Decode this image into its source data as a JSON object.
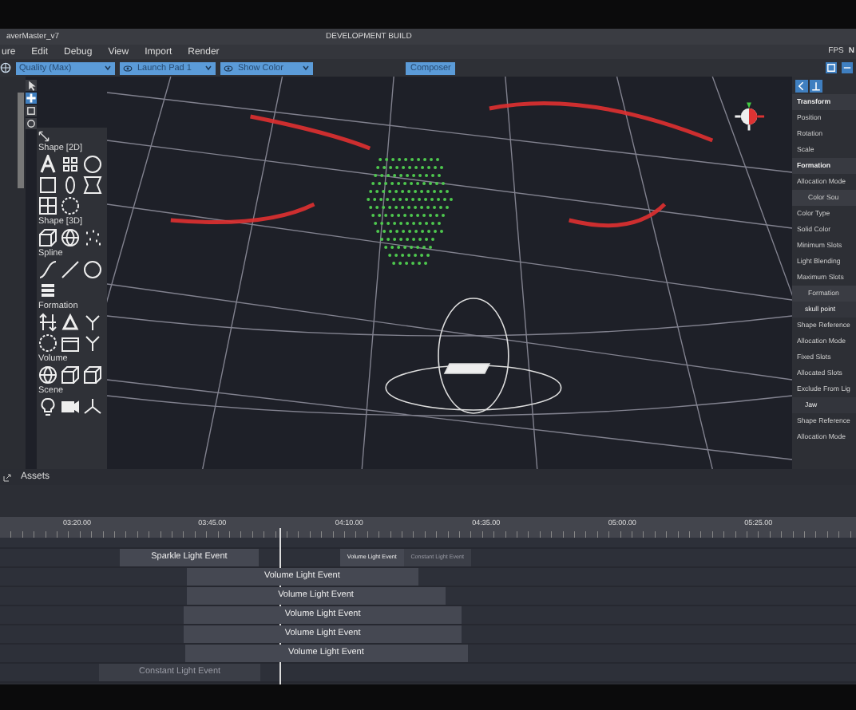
{
  "window": {
    "title": "averMaster_v7",
    "build": "DEVELOPMENT BUILD"
  },
  "menu": [
    "ure",
    "Edit",
    "Debug",
    "View",
    "Import",
    "Render"
  ],
  "toolbar": {
    "dropdowns": [
      "Quality (Max)",
      "Launch Pad 1",
      "Show Color"
    ],
    "composer": "Composer",
    "fps": "FPS",
    "fps_value": "N"
  },
  "palette": [
    "Shape [2D]",
    "Shape [3D]",
    "Spline",
    "Formation",
    "Volume",
    "Scene"
  ],
  "inspector": [
    {
      "kind": "header",
      "label": "Transform"
    },
    {
      "kind": "item",
      "label": "Position"
    },
    {
      "kind": "item",
      "label": "Rotation"
    },
    {
      "kind": "item",
      "label": "Scale"
    },
    {
      "kind": "header",
      "label": "Formation"
    },
    {
      "kind": "item",
      "label": "Allocation Mode"
    },
    {
      "kind": "sub",
      "label": "Color Sou"
    },
    {
      "kind": "item",
      "label": "Color Type"
    },
    {
      "kind": "item",
      "label": "Solid Color"
    },
    {
      "kind": "item",
      "label": "Minimum Slots"
    },
    {
      "kind": "item",
      "label": "Light Blending"
    },
    {
      "kind": "item",
      "label": "Maximum Slots"
    },
    {
      "kind": "sub",
      "label": "Formation"
    },
    {
      "kind": "list",
      "label": "skull point"
    },
    {
      "kind": "item",
      "label": "Shape Reference"
    },
    {
      "kind": "item",
      "label": "Allocation Mode"
    },
    {
      "kind": "item",
      "label": "Fixed Slots"
    },
    {
      "kind": "item",
      "label": "Allocated Slots"
    },
    {
      "kind": "item",
      "label": "Exclude From Lig"
    },
    {
      "kind": "list",
      "label": "Jaw"
    },
    {
      "kind": "item",
      "label": "Shape Reference"
    },
    {
      "kind": "item",
      "label": "Allocation Mode"
    }
  ],
  "assets": {
    "title": "Assets"
  },
  "timeline": {
    "ticks": [
      "03:20.00",
      "03:45.00",
      "04:10.00",
      "04:35.00",
      "05:00.00",
      "05:25.00"
    ],
    "tracks": [
      [
        {
          "label": "Sparkle Light Event",
          "disabled": false
        },
        {
          "label": "Volume Light Event",
          "disabled": false
        },
        {
          "label": "Constant Light Event",
          "disabled": true
        }
      ],
      [
        {
          "label": "Volume Light Event",
          "disabled": false
        }
      ],
      [
        {
          "label": "Volume Light Event",
          "disabled": false
        }
      ],
      [
        {
          "label": "Volume Light Event",
          "disabled": false
        }
      ],
      [
        {
          "label": "Volume Light Event",
          "disabled": false
        }
      ],
      [
        {
          "label": "Volume Light Event",
          "disabled": false
        }
      ],
      [
        {
          "label": "Constant Light Event",
          "disabled": true
        }
      ]
    ]
  }
}
